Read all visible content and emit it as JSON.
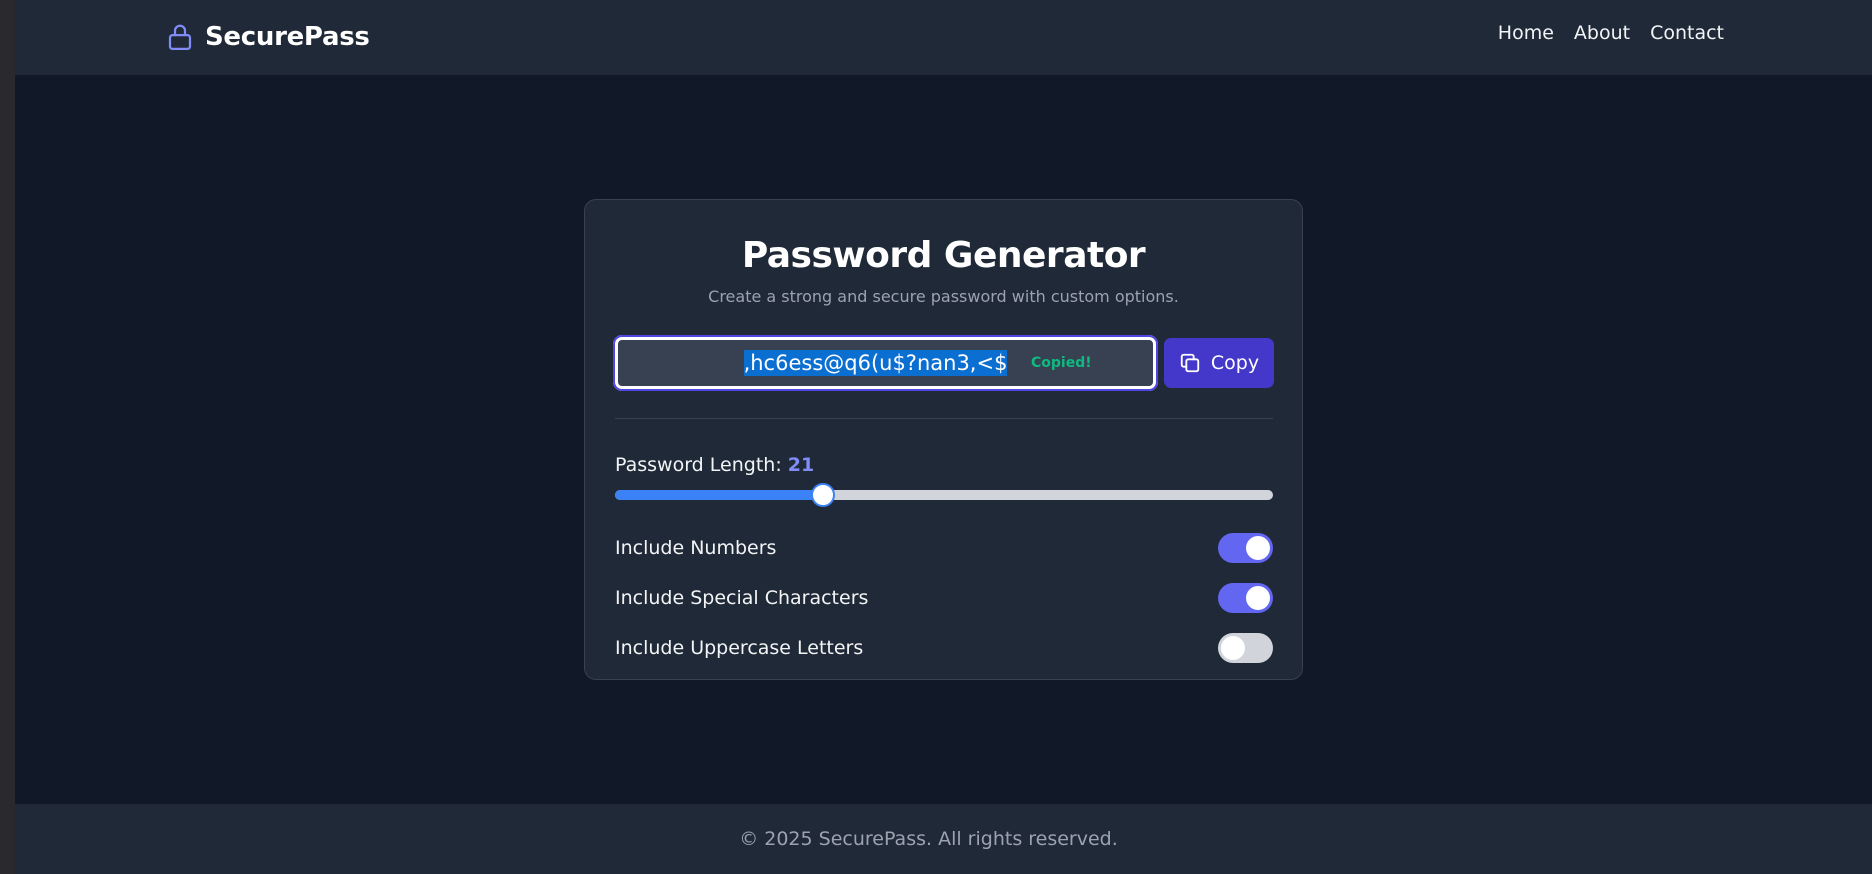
{
  "app": {
    "name": "SecurePass",
    "logo_icon": "lock-icon"
  },
  "nav": {
    "items": [
      "Home",
      "About",
      "Contact"
    ]
  },
  "generator": {
    "title": "Password Generator",
    "subtitle": "Create a strong and secure password with custom options.",
    "password": ",hc6ess@q6(u$?nan3,<$",
    "copied_text": "Copied!",
    "copy_label": "Copy",
    "copy_icon": "copy-icon",
    "length_label": "Password Length:",
    "length_value": "21",
    "length_fraction": 0.316,
    "options": [
      {
        "label": "Include Numbers",
        "enabled": true
      },
      {
        "label": "Include Special Characters",
        "enabled": true
      },
      {
        "label": "Include Uppercase Letters",
        "enabled": false
      }
    ]
  },
  "footer": {
    "text": "© 2025 SecurePass. All rights reserved."
  },
  "colors": {
    "background": "#111827",
    "surface": "#1f2937",
    "accent": "#6366f1",
    "copy_button": "#4338ca",
    "slider": "#3b82f6",
    "success": "#10b981"
  }
}
